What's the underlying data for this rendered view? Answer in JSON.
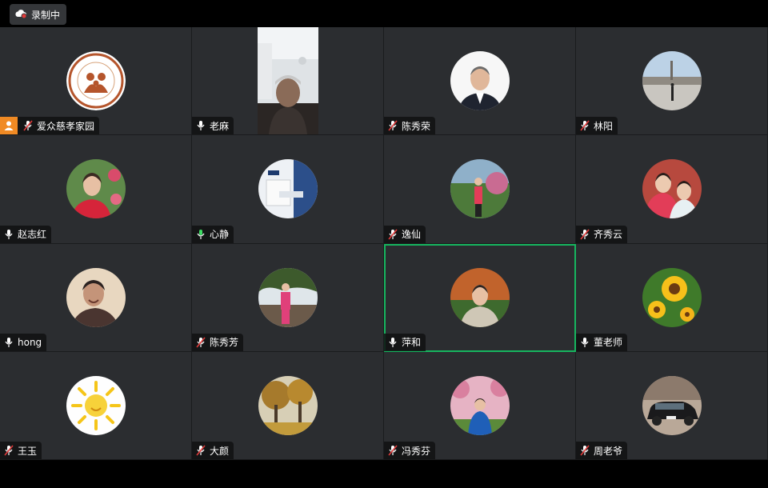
{
  "recording": {
    "label": "录制中"
  },
  "participants": [
    {
      "name": "爱众慈孝家园",
      "mic": "muted",
      "host": true,
      "avatar": "logo-avatar"
    },
    {
      "name": "老麻",
      "mic": "on",
      "avatar": "video-feed"
    },
    {
      "name": "陈秀荣",
      "mic": "muted",
      "avatar": "portrait-man"
    },
    {
      "name": "林阳",
      "mic": "muted",
      "avatar": "plaza-photo"
    },
    {
      "name": "赵志红",
      "mic": "on",
      "avatar": "woman-flowers"
    },
    {
      "name": "心静",
      "mic": "speaking",
      "avatar": "room-interior"
    },
    {
      "name": "逸仙",
      "mic": "muted",
      "avatar": "woman-park"
    },
    {
      "name": "齐秀云",
      "mic": "muted",
      "avatar": "kids-photo"
    },
    {
      "name": "hong",
      "mic": "on",
      "avatar": "woman-smiling"
    },
    {
      "name": "陈秀芳",
      "mic": "muted",
      "avatar": "woman-tree"
    },
    {
      "name": "萍和",
      "mic": "on",
      "avatar": "woman-autumn",
      "active": true
    },
    {
      "name": "董老师",
      "mic": "on",
      "avatar": "sunflowers"
    },
    {
      "name": "王玉",
      "mic": "muted",
      "avatar": "sun-drawing"
    },
    {
      "name": "大颜",
      "mic": "muted",
      "avatar": "autumn-trees"
    },
    {
      "name": "冯秀芬",
      "mic": "muted",
      "avatar": "woman-blossoms"
    },
    {
      "name": "周老爷",
      "mic": "muted",
      "avatar": "black-car"
    }
  ],
  "colors": {
    "active_border": "#16b55f",
    "host_badge": "#f08a24",
    "mic_speaking": "#3ddc64",
    "mic_muted_slash": "#e23b3b"
  }
}
